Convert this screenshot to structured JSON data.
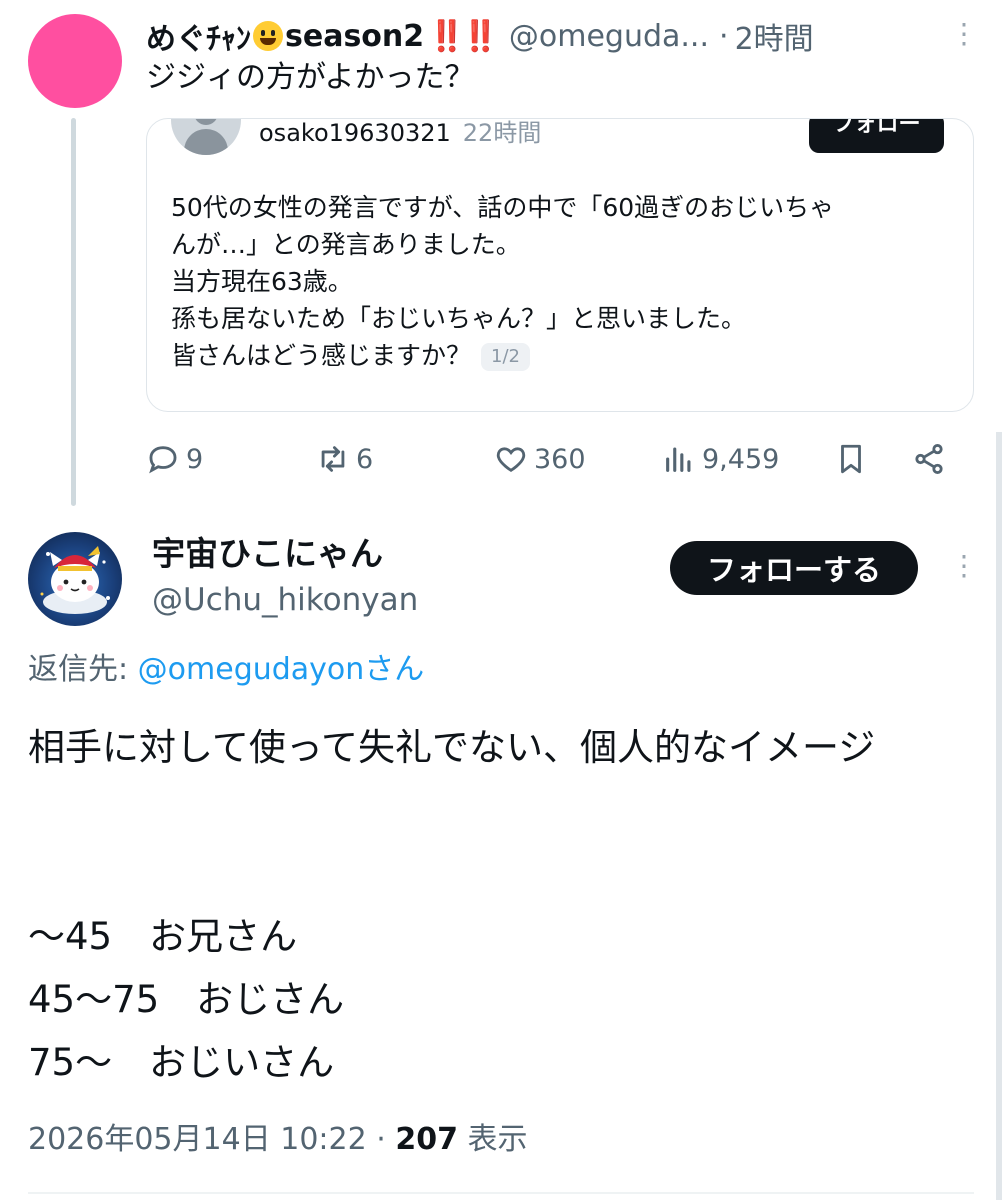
{
  "parent_post": {
    "display_name": "めぐﾁｬﾝ",
    "emoji_icon": "grinning-face-emoji",
    "name_suffix": "season2",
    "badge_marks": "‼️‼️",
    "handle": "@omeguda...",
    "separator": "·",
    "time": "2時間",
    "text": "ジジィの方がよかった？",
    "avatar_color": "#ff4fa0",
    "quoted": {
      "handle": "osako19630321",
      "time": "22時間",
      "follow_label": "フォロー",
      "lines": [
        "50代の女性の発言ですが、話の中で「60過ぎのおじいちゃ",
        "んが…」との発言ありました。",
        "当方現在63歳。",
        "孫も居ないため「おじいちゃん？」と思いました。",
        "皆さんはどう感じますか？"
      ],
      "pager": "1/2"
    },
    "actions": {
      "replies": "9",
      "reposts": "6",
      "likes": "360",
      "views": "9,459"
    }
  },
  "reply_post": {
    "display_name": "宇宙ひこにゃん",
    "handle": "@Uchu_hikonyan",
    "follow_label": "フォローする",
    "reply_to_prefix": "返信先: ",
    "reply_to_handle": "@omegudayon",
    "reply_to_suffix": "さん",
    "body": "相手に対して使って失礼でない、個人的なイメージ\n\n\n～45　お兄さん\n45～75　おじさん\n75～　おじいさん",
    "timestamp": "2026年05月14日 10:22",
    "separator": "·",
    "view_count": "207",
    "view_label": "表示"
  },
  "colors": {
    "text": "#0f1419",
    "secondary": "#536471",
    "link": "#1d9bf0",
    "button_dark": "#0f1419",
    "thread_line": "#cfd9de"
  }
}
